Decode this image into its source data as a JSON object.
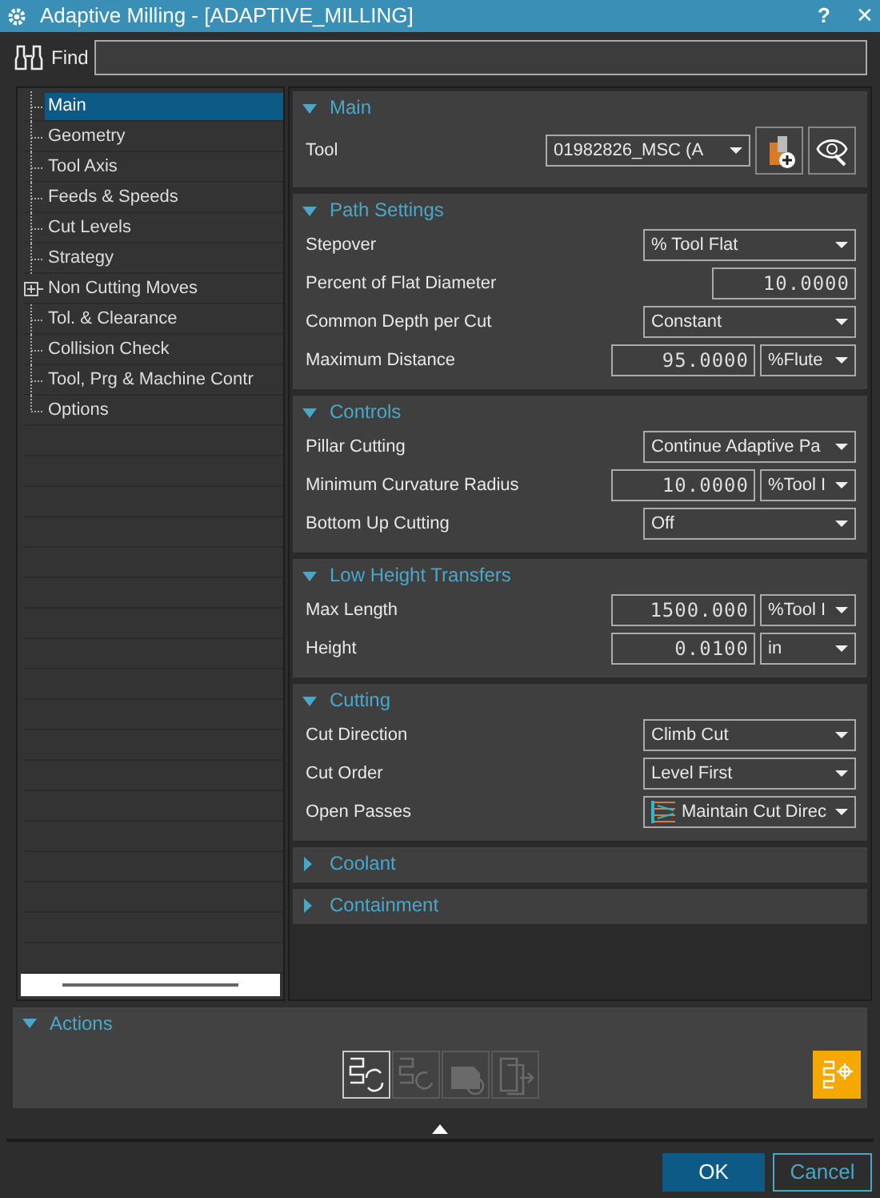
{
  "window": {
    "title": "Adaptive Milling - [ADAPTIVE_MILLING]",
    "help": "?",
    "close": "✕"
  },
  "find": {
    "label": "Find"
  },
  "tree": [
    {
      "label": "Main",
      "selected": true
    },
    {
      "label": "Geometry",
      "selected": false
    },
    {
      "label": "Tool Axis",
      "selected": false
    },
    {
      "label": "Feeds & Speeds",
      "selected": false
    },
    {
      "label": "Cut Levels",
      "selected": false
    },
    {
      "label": "Strategy",
      "selected": false
    },
    {
      "label": "Non Cutting Moves",
      "selected": false,
      "expandable": true
    },
    {
      "label": "Tol. & Clearance",
      "selected": false
    },
    {
      "label": "Collision Check",
      "selected": false
    },
    {
      "label": "Tool, Prg & Machine Contr",
      "selected": false
    },
    {
      "label": "Options",
      "selected": false
    }
  ],
  "sections": [
    {
      "title": "Main",
      "expanded": true,
      "rows": [
        {
          "kind": "tool",
          "label": "Tool",
          "value": "01982826_MSC (A"
        }
      ]
    },
    {
      "title": "Path Settings",
      "expanded": true,
      "rows": [
        {
          "kind": "dropdown",
          "label": "Stepover",
          "value": "% Tool Flat"
        },
        {
          "kind": "number",
          "label": "Percent of Flat Diameter",
          "value": "10.0000"
        },
        {
          "kind": "dropdown",
          "label": "Common Depth per Cut",
          "value": "Constant"
        },
        {
          "kind": "number_unit",
          "label": "Maximum Distance",
          "value": "95.0000",
          "unit": "%Flute"
        }
      ]
    },
    {
      "title": "Controls",
      "expanded": true,
      "rows": [
        {
          "kind": "dropdown",
          "label": "Pillar Cutting",
          "value": "Continue Adaptive Pa"
        },
        {
          "kind": "number_unit",
          "label": "Minimum Curvature Radius",
          "value": "10.0000",
          "unit": "%Tool I"
        },
        {
          "kind": "dropdown",
          "label": "Bottom Up Cutting",
          "value": "Off"
        }
      ]
    },
    {
      "title": "Low Height Transfers",
      "expanded": true,
      "rows": [
        {
          "kind": "number_unit",
          "label": "Max Length",
          "value": "1500.000",
          "unit": "%Tool I"
        },
        {
          "kind": "number_unit",
          "label": "Height",
          "value": "0.0100",
          "unit": "in"
        }
      ]
    },
    {
      "title": "Cutting",
      "expanded": true,
      "rows": [
        {
          "kind": "dropdown",
          "label": "Cut Direction",
          "value": "Climb Cut"
        },
        {
          "kind": "dropdown",
          "label": "Cut Order",
          "value": "Level First"
        },
        {
          "kind": "icon_dropdown",
          "label": "Open Passes",
          "value": "Maintain Cut Direc"
        }
      ]
    },
    {
      "title": "Coolant",
      "expanded": false
    },
    {
      "title": "Containment",
      "expanded": false
    }
  ],
  "actions": {
    "title": "Actions",
    "expanded": true,
    "buttons": [
      {
        "disabled": false
      },
      {
        "disabled": true
      },
      {
        "disabled": true
      },
      {
        "disabled": true
      }
    ]
  },
  "buttons": [
    {
      "label": "OK",
      "selected": true
    },
    {
      "label": "Cancel",
      "selected": false
    }
  ]
}
